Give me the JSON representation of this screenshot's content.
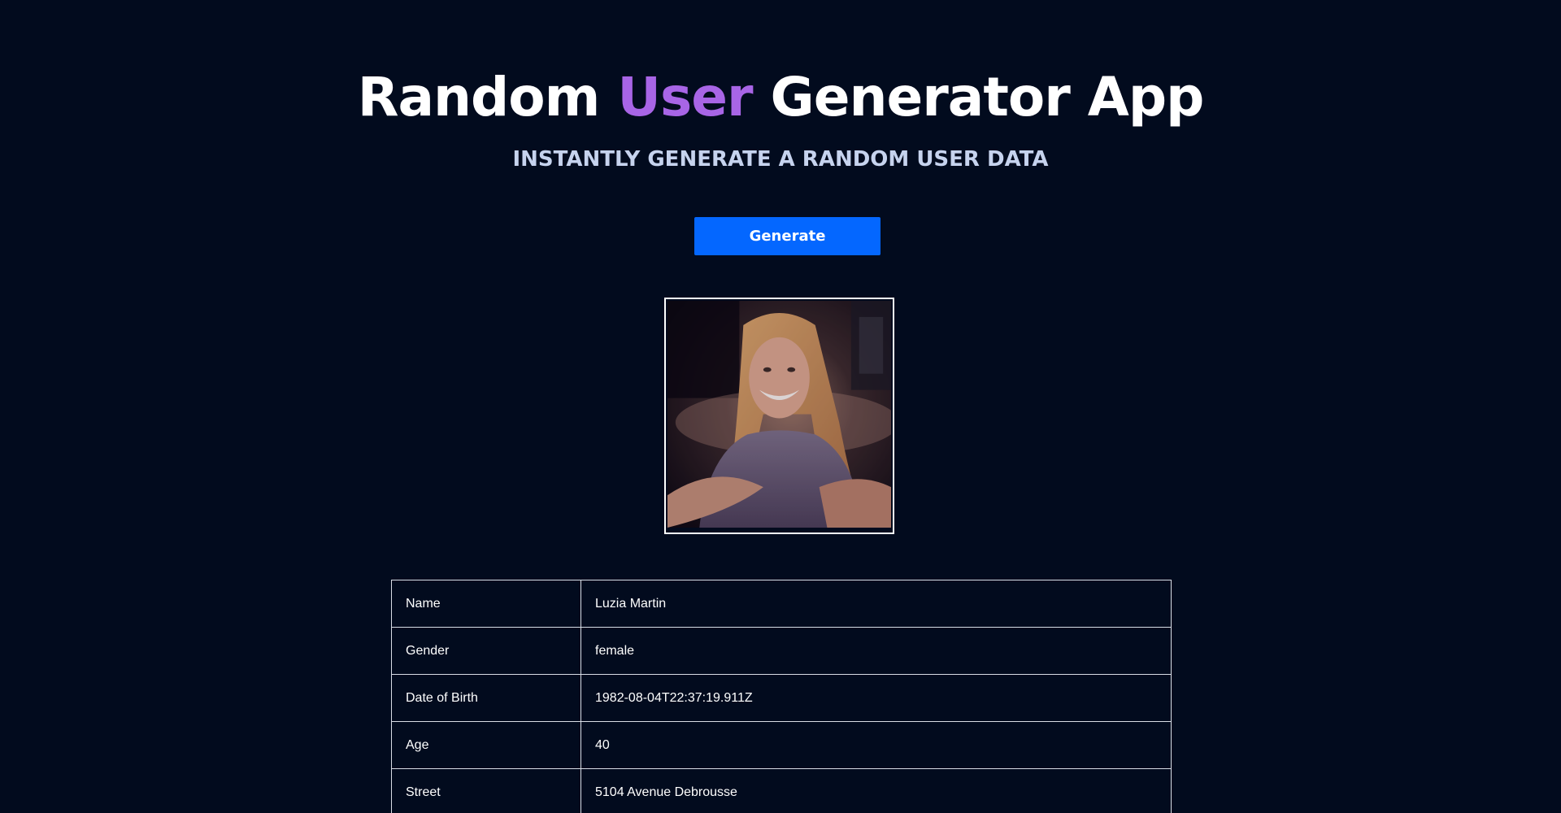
{
  "header": {
    "title_part1": "Random ",
    "title_accent": "User",
    "title_part2": " Generator App",
    "subtitle": "INSTANTLY GENERATE A RANDOM USER DATA",
    "accent_color": "#a865e6"
  },
  "actions": {
    "generate_label": "Generate",
    "button_color": "#0467ff"
  },
  "user": {
    "rows": [
      {
        "label": "Name",
        "value": "Luzia Martin"
      },
      {
        "label": "Gender",
        "value": "female"
      },
      {
        "label": "Date of Birth",
        "value": "1982-08-04T22:37:19.911Z"
      },
      {
        "label": "Age",
        "value": "40"
      },
      {
        "label": "Street",
        "value": "5104 Avenue Debrousse"
      }
    ]
  },
  "colors": {
    "background": "#020b1e",
    "subtitle": "#c6d3ee"
  }
}
